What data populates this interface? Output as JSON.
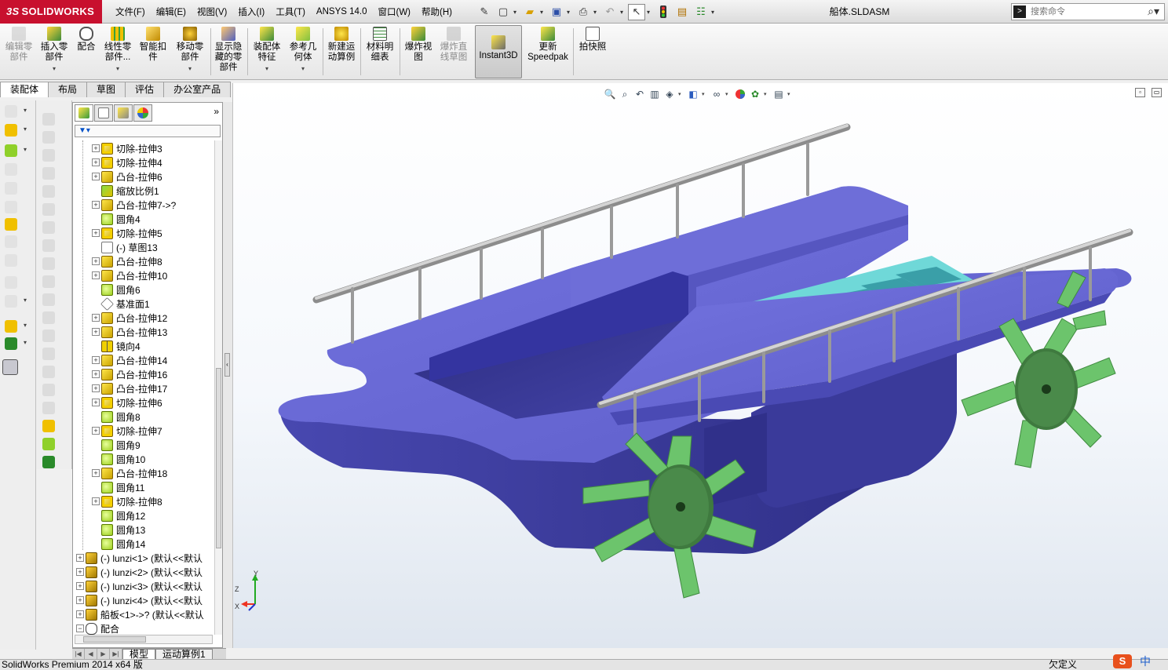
{
  "app": {
    "brand": "SOLIDWORKS",
    "brand_mark": "3S",
    "document_title": "船体.SLDASM",
    "status_left": "SolidWorks Premium 2014 x64 版",
    "status_right": "欠定义"
  },
  "menu": [
    "文件(F)",
    "编辑(E)",
    "视图(V)",
    "插入(I)",
    "工具(T)",
    "ANSYS 14.0",
    "窗口(W)",
    "帮助(H)"
  ],
  "search": {
    "placeholder": "搜索命令"
  },
  "commands": {
    "edit_component": "编辑零\n部件",
    "insert_component": "插入零\n部件",
    "mate": "配合",
    "linear_pattern": "线性零\n部件...",
    "smart_fasteners": "智能扣\n件",
    "move_component": "移动零\n部件",
    "show_hidden": "显示隐\n藏的零\n部件",
    "assembly_features": "装配体\n特征",
    "reference_geometry": "参考几\n何体",
    "new_motion_study": "新建运\n动算例",
    "bom": "材料明\n细表",
    "exploded_view": "爆炸视\n图",
    "explode_line": "爆炸直\n线草图",
    "instant3d": "Instant3D",
    "update_speedpak": "更新\nSpeedpak",
    "take_snapshot": "拍快照"
  },
  "tabs": [
    "装配体",
    "布局",
    "草图",
    "评估",
    "办公室产品"
  ],
  "tree": {
    "features": [
      {
        "label": "切除-拉伸3",
        "icon": "cut"
      },
      {
        "label": "切除-拉伸4",
        "icon": "cut"
      },
      {
        "label": "凸台-拉伸6",
        "icon": "extrude"
      },
      {
        "label": "缩放比例1",
        "icon": "scale"
      },
      {
        "label": "凸台-拉伸7->?",
        "icon": "extrude"
      },
      {
        "label": "圆角4",
        "icon": "fillet"
      },
      {
        "label": "切除-拉伸5",
        "icon": "cut"
      },
      {
        "label": "(-) 草图13",
        "icon": "sketch"
      },
      {
        "label": "凸台-拉伸8",
        "icon": "extrude"
      },
      {
        "label": "凸台-拉伸10",
        "icon": "extrude"
      },
      {
        "label": "圆角6",
        "icon": "fillet"
      },
      {
        "label": "基准面1",
        "icon": "plane"
      },
      {
        "label": "凸台-拉伸12",
        "icon": "extrude"
      },
      {
        "label": "凸台-拉伸13",
        "icon": "extrude"
      },
      {
        "label": "镜向4",
        "icon": "mirror"
      },
      {
        "label": "凸台-拉伸14",
        "icon": "extrude"
      },
      {
        "label": "凸台-拉伸16",
        "icon": "extrude"
      },
      {
        "label": "凸台-拉伸17",
        "icon": "extrude"
      },
      {
        "label": "切除-拉伸6",
        "icon": "cut"
      },
      {
        "label": "圆角8",
        "icon": "fillet"
      },
      {
        "label": "切除-拉伸7",
        "icon": "cut"
      },
      {
        "label": "圆角9",
        "icon": "fillet"
      },
      {
        "label": "圆角10",
        "icon": "fillet"
      },
      {
        "label": "凸台-拉伸18",
        "icon": "extrude"
      },
      {
        "label": "圆角11",
        "icon": "fillet"
      },
      {
        "label": "切除-拉伸8",
        "icon": "cut"
      },
      {
        "label": "圆角12",
        "icon": "fillet"
      },
      {
        "label": "圆角13",
        "icon": "fillet"
      },
      {
        "label": "圆角14",
        "icon": "fillet"
      }
    ],
    "components": [
      {
        "label": "(-) lunzi<1> (默认<<默认",
        "icon": "part"
      },
      {
        "label": "(-) lunzi<2> (默认<<默认",
        "icon": "part"
      },
      {
        "label": "(-) lunzi<3> (默认<<默认",
        "icon": "part"
      },
      {
        "label": "(-) lunzi<4> (默认<<默认",
        "icon": "part"
      },
      {
        "label": "船板<1>->? (默认<<默认",
        "icon": "part"
      },
      {
        "label": "配合",
        "icon": "mate"
      }
    ]
  },
  "bottom_tabs": [
    "模型",
    "运动算例1"
  ],
  "ime": {
    "s": "S",
    "lang": "中"
  },
  "colors": {
    "hull_top": "#6a6ad8",
    "hull_side": "#3d3d9c",
    "deck": "#6fd6d6",
    "wheel": "#6cc46c",
    "rail": "#a8a8a8",
    "brand": "#c8102e"
  }
}
